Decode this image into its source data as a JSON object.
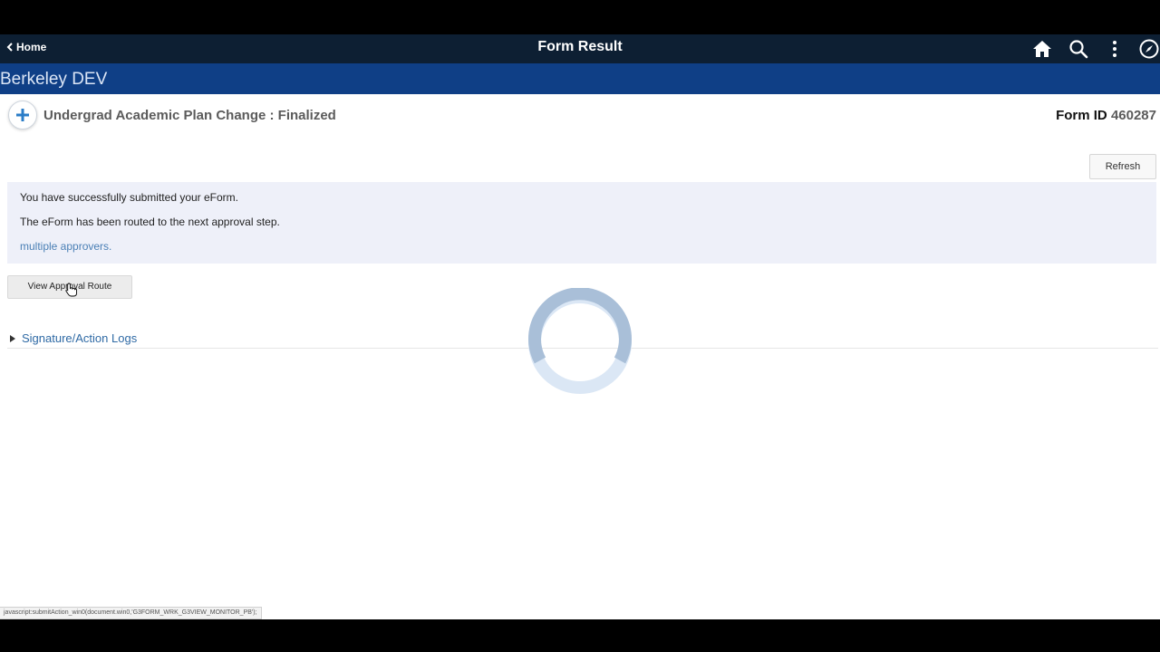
{
  "header": {
    "back_label": "Home",
    "title": "Form Result",
    "icons": [
      "home-icon",
      "search-icon",
      "more-vert-icon",
      "navbar-compass-icon"
    ]
  },
  "banner": {
    "brand": "Berkeley DEV"
  },
  "form": {
    "title": "Undergrad Academic Plan Change :  Finalized",
    "id_label": "Form ID",
    "id_value": "460287"
  },
  "actions": {
    "refresh_label": "Refresh",
    "view_route_label": "View Approval Route"
  },
  "messages": {
    "line1": "You have successfully submitted your eForm.",
    "line2": "The eForm has been routed to the next approval step.",
    "approvers_link": "multiple approvers."
  },
  "logs": {
    "label": "Signature/Action Logs"
  },
  "status_bar": {
    "text": "javascript:submitAction_win0(document.win0,'G3FORM_WRK_G3VIEW_MONITOR_PB');"
  },
  "colors": {
    "topbar": "#0d1f33",
    "banner": "#0f3f86",
    "message_bg": "#eef0f9",
    "link": "#2f6aa5"
  }
}
